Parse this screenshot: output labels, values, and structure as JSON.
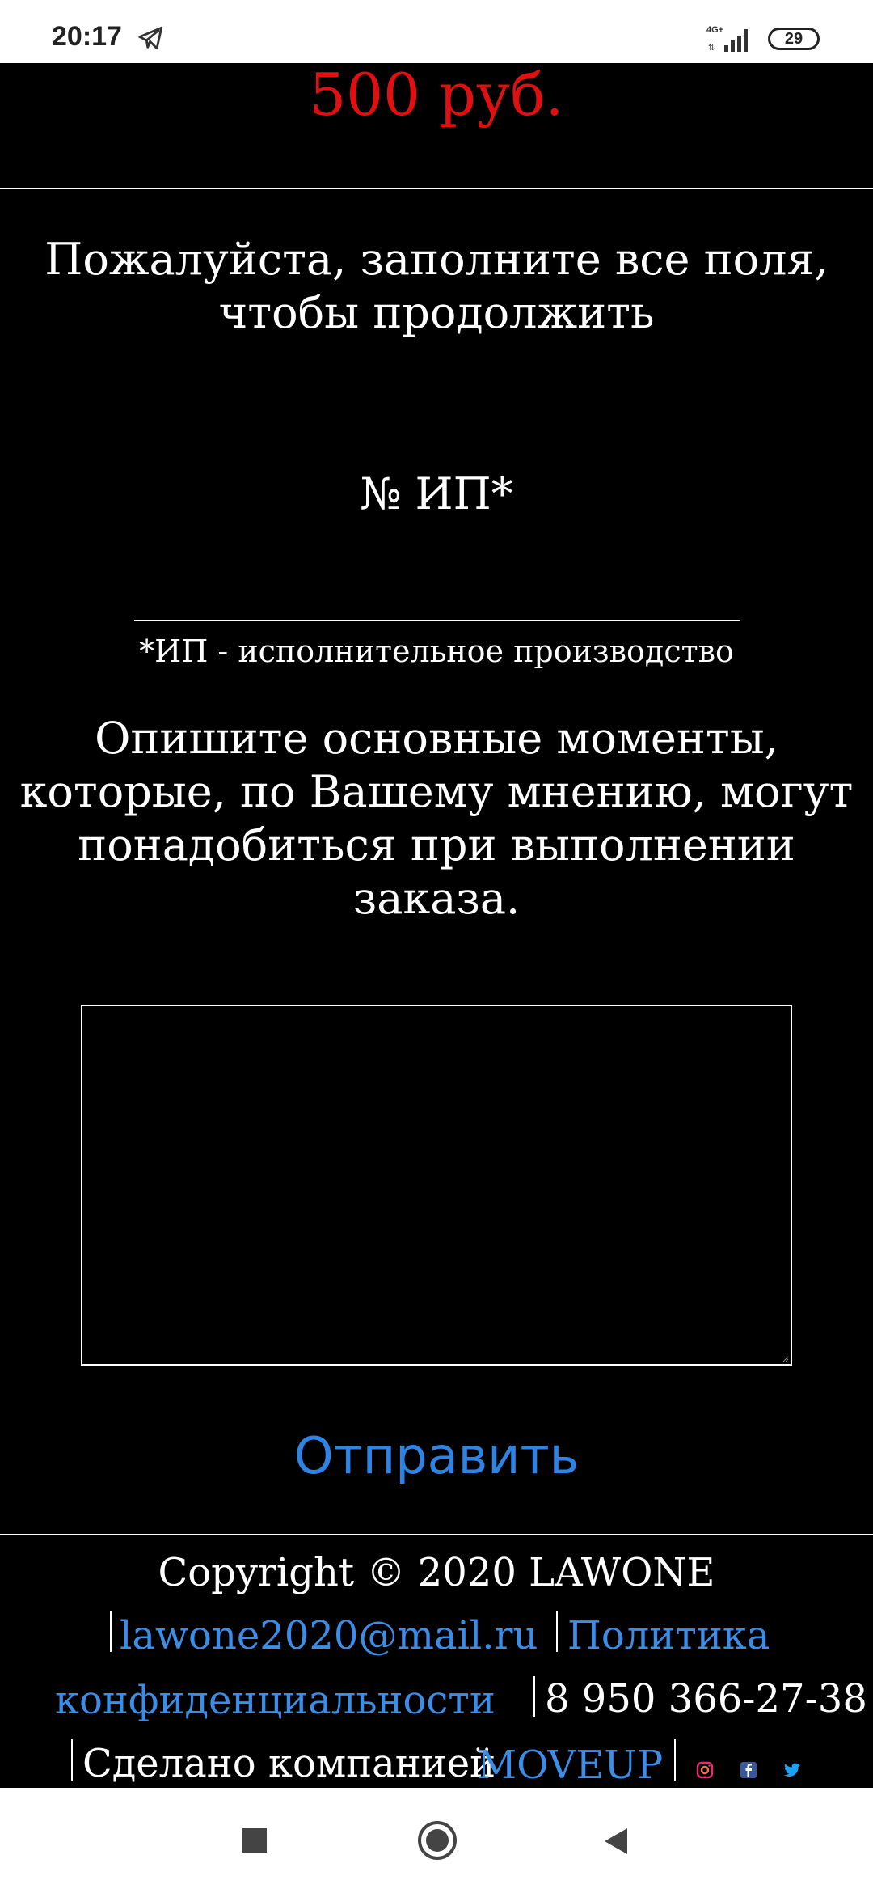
{
  "status_bar": {
    "time": "20:17",
    "network": "4G+",
    "battery": "29"
  },
  "price": "500 руб.",
  "form": {
    "title": "Пожалуйста, заполните все поля, чтобы продолжить",
    "ip_label": "№ ИП*",
    "ip_value": "",
    "ip_note": "*ИП - исполнительное производство",
    "describe_label": "Опишите основные моменты, которые, по Вашему мнению, могут понадобиться при выполнении заказа.",
    "submit_label": "Отправить"
  },
  "footer": {
    "copyright": "Copyright © 2020 LAWONE",
    "email": "lawone2020@mail.ru",
    "policy_part1": "Политика",
    "policy_part2": "конфиденциальности",
    "phone": "8 950 366-27-38",
    "made_by": "Сделано компанией",
    "company": "MOVEUP",
    "social_icons": [
      "instagram-icon",
      "facebook-icon",
      "twitter-icon"
    ]
  },
  "colors": {
    "price": "#e01010",
    "link": "#3c8de8",
    "background": "#000000"
  }
}
